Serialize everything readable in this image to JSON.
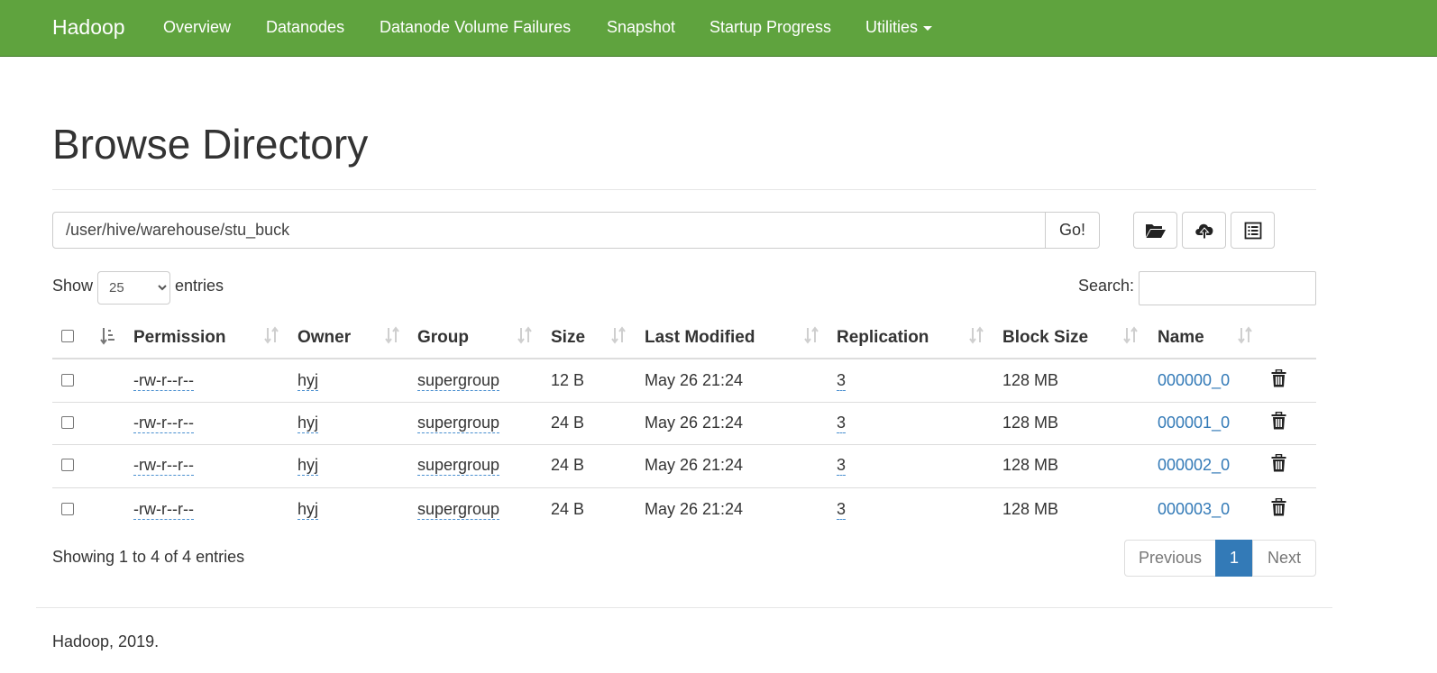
{
  "navbar": {
    "brand": "Hadoop",
    "items": [
      "Overview",
      "Datanodes",
      "Datanode Volume Failures",
      "Snapshot",
      "Startup Progress",
      "Utilities"
    ],
    "bg_color": "#5fa33e"
  },
  "page": {
    "title": "Browse Directory"
  },
  "path_bar": {
    "value": "/user/hive/warehouse/stu_buck",
    "go_label": "Go!"
  },
  "tools": {
    "icons": [
      "folder-open-icon",
      "cloud-upload-icon",
      "list-alt-icon"
    ]
  },
  "table_controls": {
    "show_label": "Show",
    "entries_options": [
      "25"
    ],
    "entries_value": "25",
    "entries_label": "entries",
    "search_label": "Search:"
  },
  "table": {
    "columns": [
      "Permission",
      "Owner",
      "Group",
      "Size",
      "Last Modified",
      "Replication",
      "Block Size",
      "Name"
    ],
    "rows": [
      {
        "permission": "-rw-r--r--",
        "owner": "hyj",
        "group": "supergroup",
        "size": "12 B",
        "modified": "May 26 21:24",
        "replication": "3",
        "block_size": "128 MB",
        "name": "000000_0"
      },
      {
        "permission": "-rw-r--r--",
        "owner": "hyj",
        "group": "supergroup",
        "size": "24 B",
        "modified": "May 26 21:24",
        "replication": "3",
        "block_size": "128 MB",
        "name": "000001_0"
      },
      {
        "permission": "-rw-r--r--",
        "owner": "hyj",
        "group": "supergroup",
        "size": "24 B",
        "modified": "May 26 21:24",
        "replication": "3",
        "block_size": "128 MB",
        "name": "000002_0"
      },
      {
        "permission": "-rw-r--r--",
        "owner": "hyj",
        "group": "supergroup",
        "size": "24 B",
        "modified": "May 26 21:24",
        "replication": "3",
        "block_size": "128 MB",
        "name": "000003_0"
      }
    ],
    "link_color": "#337ab7"
  },
  "pagination": {
    "info": "Showing 1 to 4 of 4 entries",
    "previous": "Previous",
    "current": "1",
    "next": "Next",
    "active_color": "#337ab7"
  },
  "footer": {
    "text": "Hadoop, 2019."
  }
}
